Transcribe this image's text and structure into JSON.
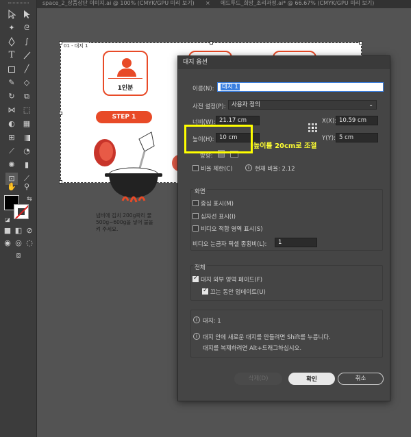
{
  "tabs": [
    {
      "label": "space_2_상품상단 이미지.ai @ 100% (CMYK/GPU 미리 보기)",
      "close": "×"
    },
    {
      "label": "에드투드_희망_조리과정.ai* @ 66.67% (CMYK/GPU 미리 보기)",
      "close": "×"
    }
  ],
  "artboard": {
    "label": "01 - 대지 1",
    "card_text": "1인분",
    "step_label": "STEP 1",
    "description": "냄비에 김치 200g짜리 물 500g~600g을 넣어 불을 켜 주세요."
  },
  "dialog": {
    "title": "대지 옵션",
    "name_label": "이름(N):",
    "name_value": "대지 1",
    "preset_label": "사전 설정(P):",
    "preset_value": "사용자 정의",
    "width_label": "너비(W):",
    "width_value": "21.17 cm",
    "height_label": "높이(H):",
    "height_value": "10 cm",
    "x_label": "X(X):",
    "x_value": "10.59 cm",
    "y_label": "Y(Y):",
    "y_value": "5 cm",
    "orientation_label": "방향:",
    "constrain_label": "비율 제한(C)",
    "current_ratio": "현재 비율: 2.12",
    "display_title": "화면",
    "show_center": "중심 표시(M)",
    "show_cross": "십자선 표시(I)",
    "show_video_safe": "비디오 적합 영역 표시(S)",
    "video_ratio_label": "비디오 눈금자 픽셀 종횡비(L):",
    "video_ratio_value": "1",
    "global_title": "전체",
    "fade_outside": "대지 외부 영역 페이드(F)",
    "update_drag": "끄는 동안 업데이트(U)",
    "artboards_count": "대지: 1",
    "tip_line1": "대지 안에 새로운 대지를 만들려면 Shift를 누릅니다.",
    "tip_line2": "대지를 복제하려면 Alt+드래그하십시오.",
    "delete_button": "삭제(D)",
    "ok_button": "확인",
    "cancel_button": "취소"
  },
  "annotation": {
    "note": "높이를 20cm로 조절",
    "color": "#ffff00"
  },
  "colors": {
    "accent": "#e84a27",
    "dialog_bg": "#454545"
  }
}
